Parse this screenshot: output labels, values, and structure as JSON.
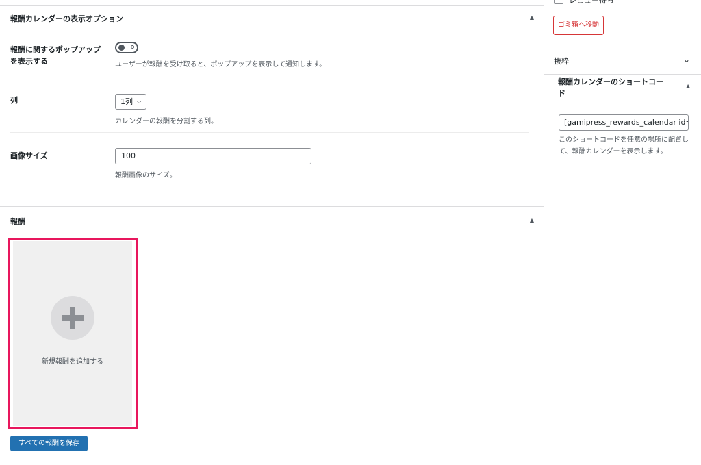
{
  "display_options": {
    "title": "報酬カレンダーの表示オプション",
    "popup_label": "報酬に関するポップアップを表示する",
    "popup_desc": "ユーザーが報酬を受け取ると、ポップアップを表示して通知します。",
    "popup_enabled": false,
    "columns_label": "列",
    "columns_value": "1列",
    "columns_desc": "カレンダーの報酬を分割する列。",
    "image_size_label": "画像サイズ",
    "image_size_value": "100",
    "image_size_desc": "報酬画像のサイズ。"
  },
  "rewards": {
    "title": "報酬",
    "add_label": "新規報酬を追加する",
    "save_label": "すべての報酬を保存"
  },
  "sidebar": {
    "checkbox_label": "レビュー待ち",
    "trash_label": "ゴミ箱へ移動",
    "excerpt_title": "抜粋",
    "shortcode_title": "報酬カレンダーのショートコード",
    "shortcode_value": "[gamipress_rewards_calendar id=",
    "shortcode_desc": "このショートコードを任意の場所に配置して、報酬カレンダーを表示します。"
  },
  "colors": {
    "accent": "#2271b1",
    "danger": "#d63638",
    "highlight": "#e8175d"
  }
}
